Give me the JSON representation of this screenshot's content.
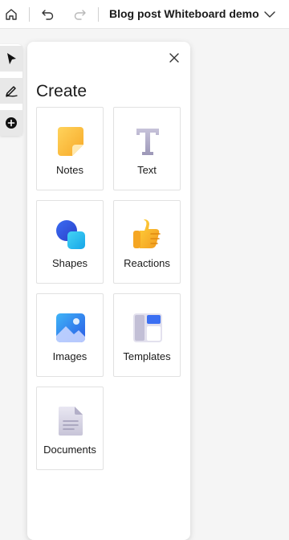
{
  "header": {
    "title": "Blog post Whiteboard demo",
    "home_icon": "home-icon",
    "undo_icon": "undo-icon",
    "redo_icon": "redo-icon",
    "menu_icon": "chevron-down-icon"
  },
  "toolrail": {
    "items": [
      {
        "icon": "select-cursor-icon",
        "active": true
      },
      {
        "icon": "pen-icon",
        "active": true
      },
      {
        "icon": "add-circle-icon",
        "active": true
      }
    ]
  },
  "create_panel": {
    "title": "Create",
    "close_icon": "close-icon",
    "items": [
      {
        "label": "Notes",
        "icon": "sticky-note-icon"
      },
      {
        "label": "Text",
        "icon": "text-icon"
      },
      {
        "label": "Shapes",
        "icon": "shapes-icon"
      },
      {
        "label": "Reactions",
        "icon": "thumbs-up-icon"
      },
      {
        "label": "Images",
        "icon": "image-icon"
      },
      {
        "label": "Templates",
        "icon": "templates-icon"
      },
      {
        "label": "Documents",
        "icon": "document-icon"
      }
    ]
  },
  "colors": {
    "panel_bg": "#ffffff",
    "canvas_bg": "#f5f5f5",
    "text": "#1b1b1b",
    "tile_border": "#e1e1e1"
  }
}
